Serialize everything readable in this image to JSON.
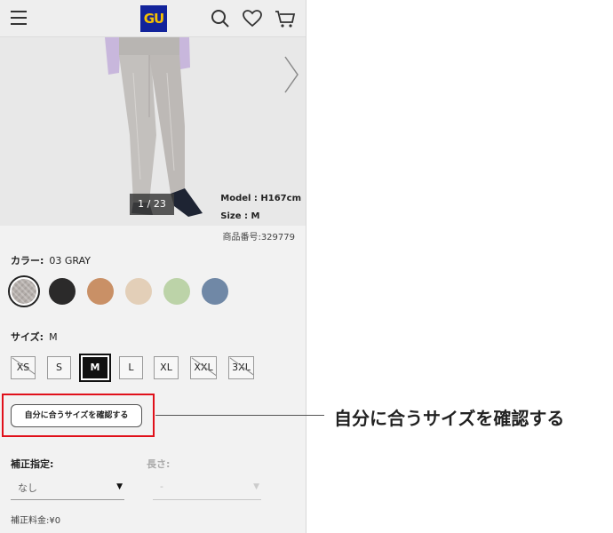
{
  "header": {
    "logo_text": "GU",
    "icons": [
      "menu-icon",
      "search-icon",
      "heart-icon",
      "cart-icon"
    ]
  },
  "hero": {
    "pager": "1 / 23",
    "model_height": "Model : H167cm",
    "model_size": "Size : M"
  },
  "product_number": "商品番号:329779",
  "color": {
    "label": "カラー:",
    "value": "03 GRAY",
    "swatches": [
      "#b5afab",
      "#2b2a2a",
      "#c99066",
      "#e3cfb8",
      "#bcd3a8",
      "#7088a6"
    ]
  },
  "size": {
    "label": "サイズ:",
    "value": "M",
    "options": [
      {
        "label": "XS",
        "state": "unavailable"
      },
      {
        "label": "S",
        "state": "available"
      },
      {
        "label": "M",
        "state": "selected"
      },
      {
        "label": "L",
        "state": "available"
      },
      {
        "label": "XL",
        "state": "available"
      },
      {
        "label": "XXL",
        "state": "unavailable"
      },
      {
        "label": "3XL",
        "state": "unavailable"
      }
    ]
  },
  "fit_button": "自分に合うサイズを確認する",
  "callout": "自分に合うサイズを確認する",
  "alteration": {
    "label": "補正指定:",
    "value": "なし",
    "length_label": "長さ:",
    "length_value": "-",
    "fee": "補正料金:¥0"
  },
  "colors": {
    "accent_red": "#e0101a",
    "logo_blue": "#12239b",
    "logo_yellow": "#f6c100"
  }
}
